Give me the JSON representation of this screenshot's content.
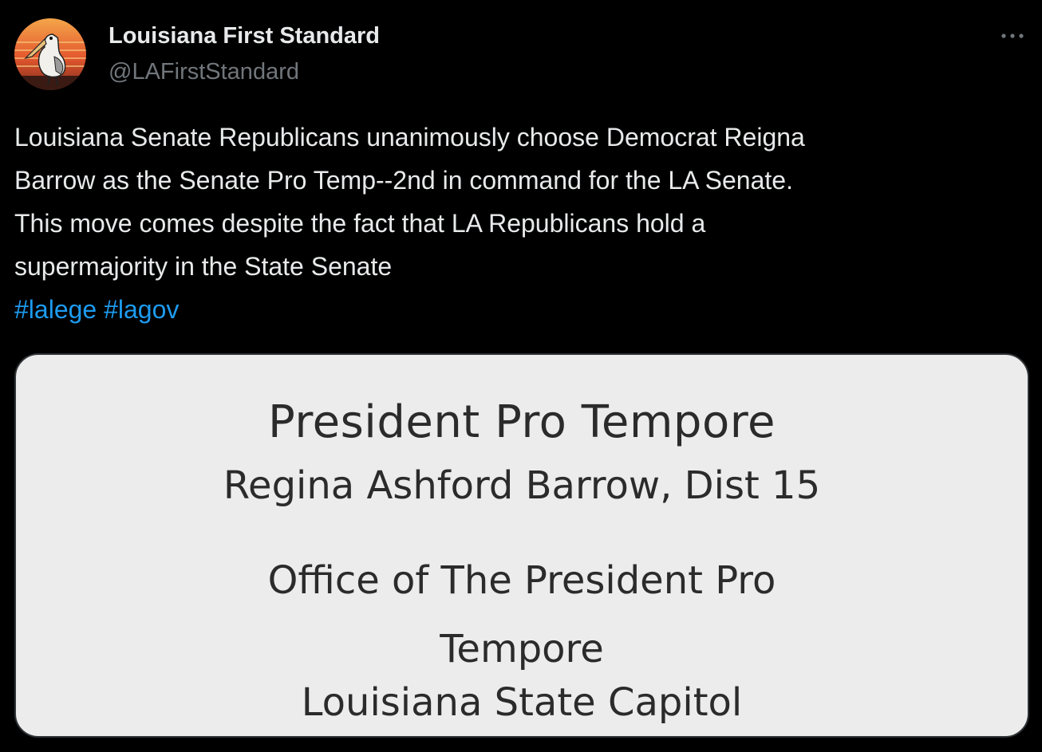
{
  "author": {
    "display_name": "Louisiana First Standard",
    "handle": "@LAFirstStandard",
    "avatar_icon": "pelican-sunset-avatar"
  },
  "more_icon": "more-options-icon",
  "tweet": {
    "text": "Louisiana Senate Republicans unanimously choose Democrat Reigna\nBarrow as the Senate Pro Temp--2nd in command for the LA Senate.\nThis move comes despite the fact that LA Republicans hold a\nsupermajority in the State Senate",
    "hashtags": [
      "#lalege",
      "#lagov"
    ]
  },
  "media": {
    "title": "President Pro Tempore",
    "name": "Regina Ashford Barrow, Dist 15",
    "office": "Office of The President Pro\nTempore",
    "location": "Louisiana State Capitol"
  },
  "colors": {
    "background": "#000000",
    "text": "#e7e9ea",
    "secondary_text": "#71767b",
    "link": "#1d9bf0",
    "media_background": "#ececec"
  }
}
